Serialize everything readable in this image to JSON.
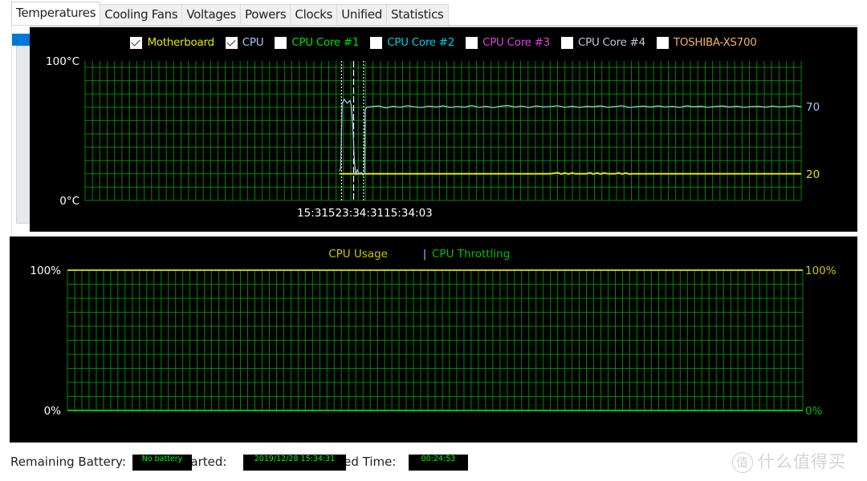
{
  "tabs": [
    {
      "label": "Temperatures",
      "active": true
    },
    {
      "label": "Cooling Fans",
      "active": false
    },
    {
      "label": "Voltages",
      "active": false
    },
    {
      "label": "Powers",
      "active": false
    },
    {
      "label": "Clocks",
      "active": false
    },
    {
      "label": "Unified",
      "active": false
    },
    {
      "label": "Statistics",
      "active": false
    }
  ],
  "colors": {
    "grid": "#00a000",
    "motherboard": "#e6e600",
    "cpu": "#a8c8f0",
    "core1": "#00e000",
    "core2": "#00d0e0",
    "core3": "#e040e0",
    "core4": "#c0c8d0",
    "toshiba": "#f0b070",
    "usage": "#c8c800",
    "throttling": "#00c000"
  },
  "chart_data": [
    {
      "type": "line",
      "title": "Temperatures",
      "ylabel_top": "100°C",
      "ylabel_bottom": "0°C",
      "ylim": [
        0,
        100
      ],
      "legend": [
        {
          "label": "Motherboard",
          "checked": true,
          "color_key": "motherboard"
        },
        {
          "label": "CPU",
          "checked": true,
          "color_key": "cpu"
        },
        {
          "label": "CPU Core #1",
          "checked": false,
          "color_key": "core1"
        },
        {
          "label": "CPU Core #2",
          "checked": false,
          "color_key": "core2"
        },
        {
          "label": "CPU Core #3",
          "checked": false,
          "color_key": "core3"
        },
        {
          "label": "CPU Core #4",
          "checked": false,
          "color_key": "core4"
        },
        {
          "label": "TOSHIBA-XS700",
          "checked": false,
          "color_key": "toshiba"
        }
      ],
      "time_labels_text": "15:31523:34:3115:34:03",
      "time_markers": [
        {
          "label": "15:31:52",
          "pos": 0.358,
          "style": "dotted"
        },
        {
          "label": "15:34:31",
          "pos": 0.375,
          "style": "dashed"
        },
        {
          "label": "15:34:03",
          "pos": 0.389,
          "style": "dotted"
        }
      ],
      "series": [
        {
          "name": "CPU",
          "color_key": "cpu",
          "end_label": "70",
          "points": [
            [
              0.355,
              22
            ],
            [
              0.357,
              24
            ],
            [
              0.359,
              73
            ],
            [
              0.362,
              76
            ],
            [
              0.366,
              73
            ],
            [
              0.37,
              75
            ],
            [
              0.372,
              71
            ],
            [
              0.374,
              55
            ],
            [
              0.376,
              30
            ],
            [
              0.378,
              19
            ],
            [
              0.38,
              23
            ],
            [
              0.383,
              20
            ],
            [
              0.386,
              21
            ],
            [
              0.388,
              19
            ],
            [
              0.39,
              20
            ],
            [
              0.391,
              68
            ],
            [
              0.393,
              70
            ],
            [
              0.4,
              70.5
            ],
            [
              0.41,
              71
            ],
            [
              0.42,
              69.5
            ],
            [
              0.43,
              70.8
            ],
            [
              0.44,
              70
            ],
            [
              0.45,
              71.2
            ],
            [
              0.46,
              70.3
            ],
            [
              0.47,
              69.8
            ],
            [
              0.48,
              70.9
            ],
            [
              0.49,
              70.2
            ],
            [
              0.5,
              71.1
            ],
            [
              0.51,
              69.9
            ],
            [
              0.52,
              70.6
            ],
            [
              0.53,
              70.1
            ],
            [
              0.54,
              71.3
            ],
            [
              0.55,
              70.0
            ],
            [
              0.56,
              70.7
            ],
            [
              0.57,
              69.7
            ],
            [
              0.58,
              70.8
            ],
            [
              0.59,
              71.4
            ],
            [
              0.6,
              70.2
            ],
            [
              0.61,
              70.9
            ],
            [
              0.62,
              69.8
            ],
            [
              0.63,
              71.0
            ],
            [
              0.64,
              70.3
            ],
            [
              0.65,
              70.6
            ],
            [
              0.66,
              71.2
            ],
            [
              0.67,
              70.0
            ],
            [
              0.68,
              70.8
            ],
            [
              0.69,
              69.9
            ],
            [
              0.7,
              70.7
            ],
            [
              0.71,
              70.4
            ],
            [
              0.72,
              71.1
            ],
            [
              0.73,
              70.0
            ],
            [
              0.74,
              70.6
            ],
            [
              0.75,
              71.2
            ],
            [
              0.76,
              69.8
            ],
            [
              0.77,
              70.5
            ],
            [
              0.78,
              70.9
            ],
            [
              0.79,
              70.2
            ],
            [
              0.8,
              71.0
            ],
            [
              0.81,
              70.3
            ],
            [
              0.82,
              70.7
            ],
            [
              0.83,
              69.9
            ],
            [
              0.84,
              71.1
            ],
            [
              0.85,
              70.4
            ],
            [
              0.86,
              70.8
            ],
            [
              0.87,
              70.0
            ],
            [
              0.88,
              70.6
            ],
            [
              0.89,
              71.0
            ],
            [
              0.9,
              70.2
            ],
            [
              0.91,
              70.8
            ],
            [
              0.92,
              70.0
            ],
            [
              0.93,
              70.5
            ],
            [
              0.94,
              70.7
            ],
            [
              0.95,
              70.1
            ],
            [
              0.96,
              70.9
            ],
            [
              0.97,
              70.3
            ],
            [
              0.98,
              70.6
            ],
            [
              0.99,
              71.2
            ],
            [
              1.0,
              70.5
            ]
          ]
        },
        {
          "name": "Motherboard",
          "color_key": "motherboard",
          "end_label": "20",
          "points": [
            [
              0.355,
              20
            ],
            [
              0.65,
              20
            ],
            [
              0.66,
              20.8
            ],
            [
              0.665,
              19.8
            ],
            [
              0.67,
              20.6
            ],
            [
              0.675,
              19.8
            ],
            [
              0.68,
              20.6
            ],
            [
              0.685,
              20
            ],
            [
              0.7,
              20
            ],
            [
              0.705,
              20.7
            ],
            [
              0.71,
              19.8
            ],
            [
              0.715,
              20.6
            ],
            [
              0.72,
              19.8
            ],
            [
              0.725,
              20.6
            ],
            [
              0.73,
              20
            ],
            [
              0.74,
              20
            ],
            [
              0.745,
              20.7
            ],
            [
              0.75,
              19.8
            ],
            [
              0.755,
              20.6
            ],
            [
              0.76,
              19.8
            ],
            [
              0.765,
              20
            ],
            [
              1.0,
              20
            ]
          ]
        }
      ]
    },
    {
      "type": "line",
      "title": "CPU Usage | CPU Throttling",
      "legend": [
        {
          "label": "CPU Usage",
          "color_key": "usage"
        },
        {
          "label": "CPU Throttling",
          "color_key": "throttling"
        }
      ],
      "legend_separator": "|",
      "ylabel_left_top": "100%",
      "ylabel_left_bottom": "0%",
      "ylabel_right_top": "100%",
      "ylabel_right_bottom": "0%",
      "ylim": [
        0,
        100
      ],
      "series": [
        {
          "name": "CPU Usage",
          "values": [
            100
          ],
          "color_key": "usage"
        },
        {
          "name": "CPU Throttling",
          "values": [
            0
          ],
          "color_key": "throttling"
        }
      ]
    }
  ],
  "status": {
    "battery_label": "Remaining Battery:",
    "battery_value": "No battery",
    "started_label": "Started:",
    "started_value": "2019/12/28 15:34:31",
    "elapsed_label": "Elapsed Time:",
    "elapsed_value": "00:24:53"
  },
  "watermark": {
    "circle": "值",
    "text": "什么值得买"
  }
}
